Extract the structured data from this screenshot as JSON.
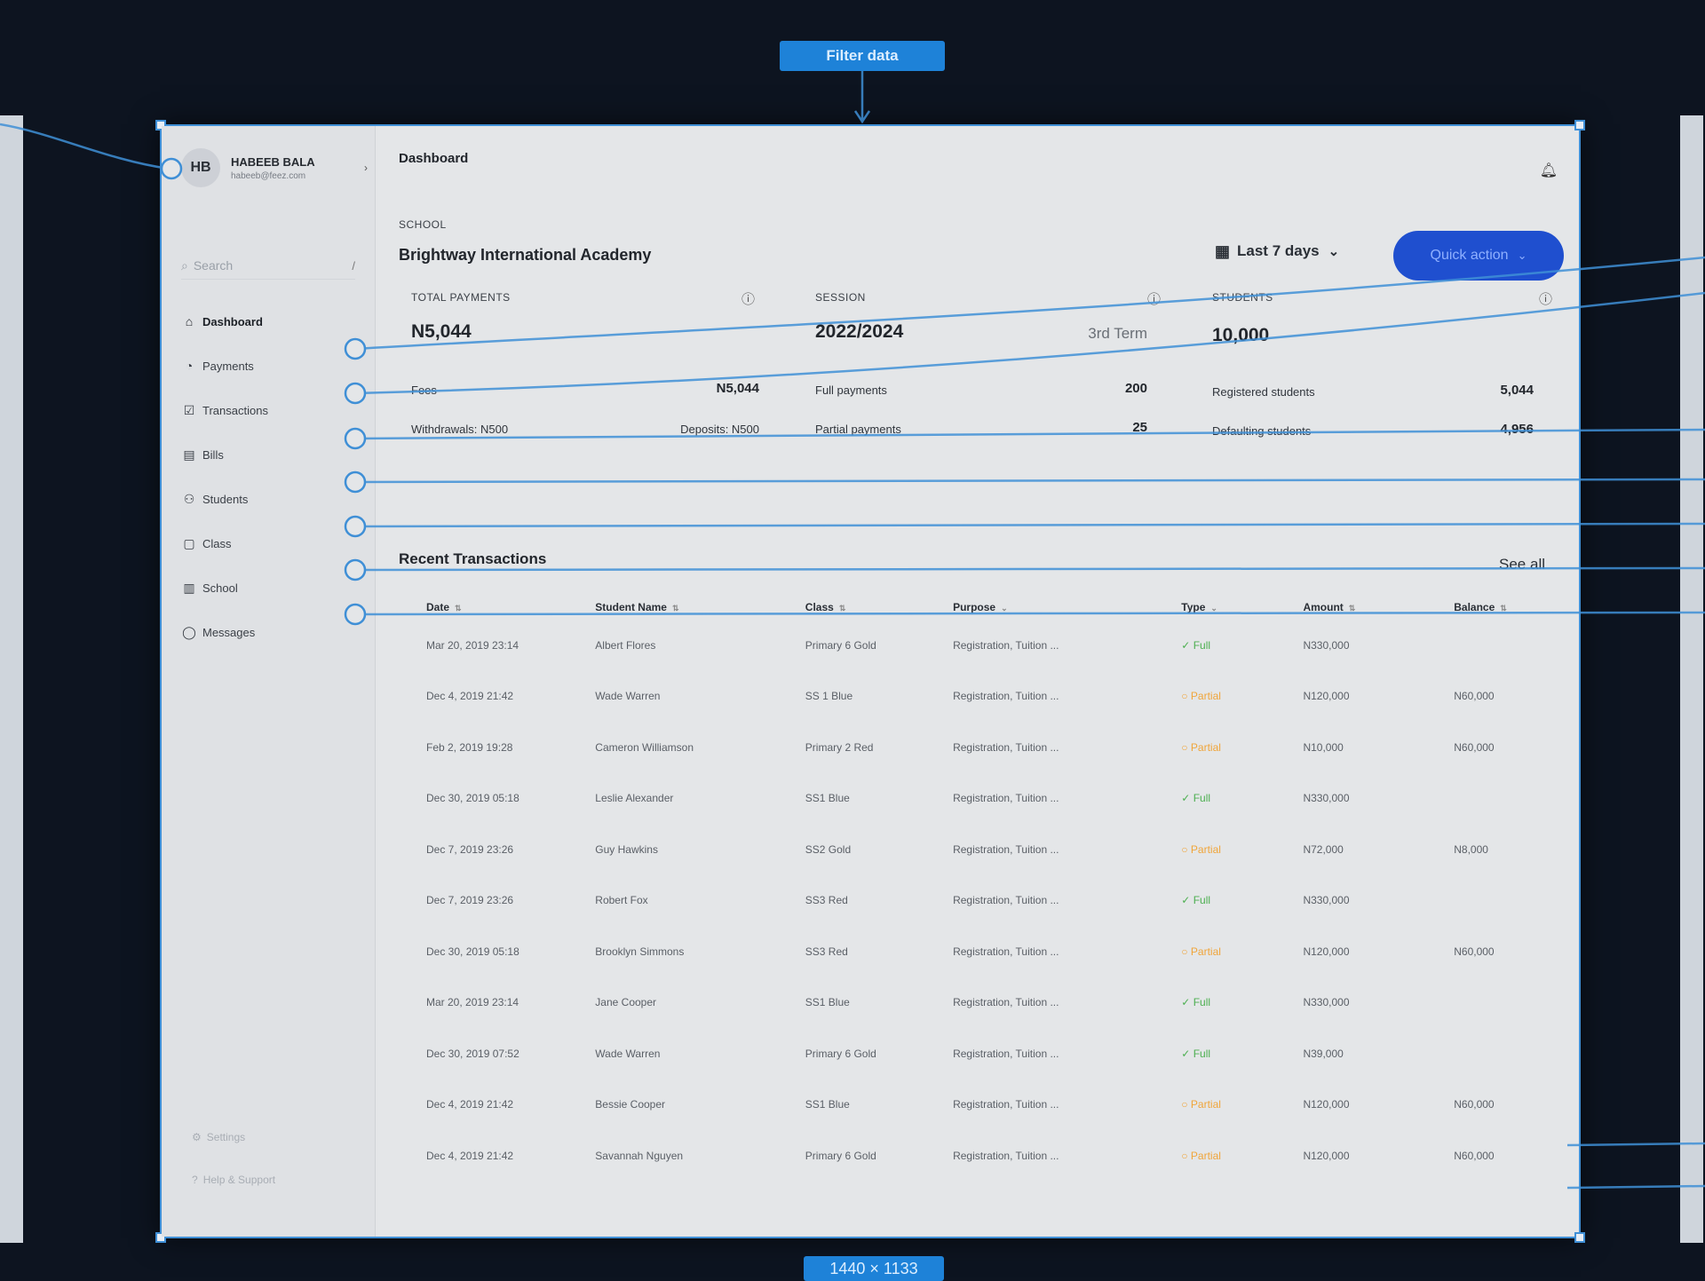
{
  "canvas": {
    "flow_tag": "Filter data",
    "frame_size": "1440 × 1133"
  },
  "sidebar": {
    "user": {
      "initials": "HB",
      "name": "HABEEB BALA",
      "email": "habeeb@feez.com"
    },
    "search": {
      "placeholder": "Search",
      "shortcut": "/"
    },
    "items": [
      {
        "label": "Dashboard",
        "icon": "home-icon",
        "active": true
      },
      {
        "label": "Payments",
        "icon": "payments-icon",
        "active": false
      },
      {
        "label": "Transactions",
        "icon": "transactions-icon",
        "active": false
      },
      {
        "label": "Bills",
        "icon": "bills-icon",
        "active": false
      },
      {
        "label": "Students",
        "icon": "students-icon",
        "active": false
      },
      {
        "label": "Class",
        "icon": "class-icon",
        "active": false
      },
      {
        "label": "School",
        "icon": "school-icon",
        "active": false
      },
      {
        "label": "Messages",
        "icon": "messages-icon",
        "active": false
      }
    ],
    "bottom": [
      {
        "label": "Settings",
        "icon": "gear-icon"
      },
      {
        "label": "Help & Support",
        "icon": "help-icon"
      }
    ]
  },
  "header": {
    "title": "Dashboard",
    "school_label": "SCHOOL",
    "school_name": "Brightway International Academy",
    "date_range": "Last 7 days",
    "quick_action": "Quick action"
  },
  "stats": {
    "total_payments": {
      "label": "TOTAL PAYMENTS",
      "value": "N5,044",
      "fees_label": "Fees",
      "fees_value": "N5,044",
      "withdrawals": "Withdrawals: N500",
      "deposits": "Deposits: N500"
    },
    "session": {
      "label": "SESSION",
      "value": "2022/2024",
      "term": "3rd Term",
      "full_label": "Full payments",
      "full_value": "200",
      "partial_label": "Partial payments",
      "partial_value": "25"
    },
    "students": {
      "label": "STUDENTS",
      "value": "10,000",
      "registered_label": "Registered students",
      "registered_value": "5,044",
      "defaulting_label": "Defaulting students",
      "defaulting_value": "4,956"
    }
  },
  "recent": {
    "title": "Recent Transactions",
    "see_all": "See all",
    "columns": [
      "Date",
      "Student Name",
      "Class",
      "Purpose",
      "Type",
      "Amount",
      "Balance"
    ],
    "rows": [
      {
        "date": "Mar 20, 2019 23:14",
        "name": "Albert Flores",
        "class": "Primary 6 Gold",
        "purpose": "Registration, Tuition ...",
        "type": "Full",
        "amount": "N330,000",
        "balance": ""
      },
      {
        "date": "Dec 4, 2019 21:42",
        "name": "Wade Warren",
        "class": "SS 1 Blue",
        "purpose": "Registration, Tuition ...",
        "type": "Partial",
        "amount": "N120,000",
        "balance": "N60,000"
      },
      {
        "date": "Feb 2, 2019 19:28",
        "name": "Cameron Williamson",
        "class": "Primary 2 Red",
        "purpose": "Registration, Tuition ...",
        "type": "Partial",
        "amount": "N10,000",
        "balance": "N60,000"
      },
      {
        "date": "Dec 30, 2019 05:18",
        "name": "Leslie Alexander",
        "class": "SS1 Blue",
        "purpose": "Registration, Tuition ...",
        "type": "Full",
        "amount": "N330,000",
        "balance": ""
      },
      {
        "date": "Dec 7, 2019 23:26",
        "name": "Guy Hawkins",
        "class": "SS2 Gold",
        "purpose": "Registration, Tuition ...",
        "type": "Partial",
        "amount": "N72,000",
        "balance": "N8,000"
      },
      {
        "date": "Dec 7, 2019 23:26",
        "name": "Robert Fox",
        "class": "SS3 Red",
        "purpose": "Registration, Tuition ...",
        "type": "Full",
        "amount": "N330,000",
        "balance": ""
      },
      {
        "date": "Dec 30, 2019 05:18",
        "name": "Brooklyn Simmons",
        "class": "SS3 Red",
        "purpose": "Registration, Tuition ...",
        "type": "Partial",
        "amount": "N120,000",
        "balance": "N60,000"
      },
      {
        "date": "Mar 20, 2019 23:14",
        "name": "Jane Cooper",
        "class": "SS1 Blue",
        "purpose": "Registration, Tuition ...",
        "type": "Full",
        "amount": "N330,000",
        "balance": ""
      },
      {
        "date": "Dec 30, 2019 07:52",
        "name": "Wade Warren",
        "class": "Primary 6 Gold",
        "purpose": "Registration, Tuition ...",
        "type": "Full",
        "amount": "N39,000",
        "balance": ""
      },
      {
        "date": "Dec 4, 2019 21:42",
        "name": "Bessie Cooper",
        "class": "SS1 Blue",
        "purpose": "Registration, Tuition ...",
        "type": "Partial",
        "amount": "N120,000",
        "balance": "N60,000"
      },
      {
        "date": "Dec 4, 2019 21:42",
        "name": "Savannah Nguyen",
        "class": "Primary 6 Gold",
        "purpose": "Registration, Tuition ...",
        "type": "Partial",
        "amount": "N120,000",
        "balance": "N60,000"
      }
    ]
  },
  "colors": {
    "accent": "#1f4fcf",
    "prototype_wire": "#3f8fd6",
    "full": "#4caf50",
    "partial": "#f0a53a",
    "canvas_bg": "#0d1420"
  }
}
